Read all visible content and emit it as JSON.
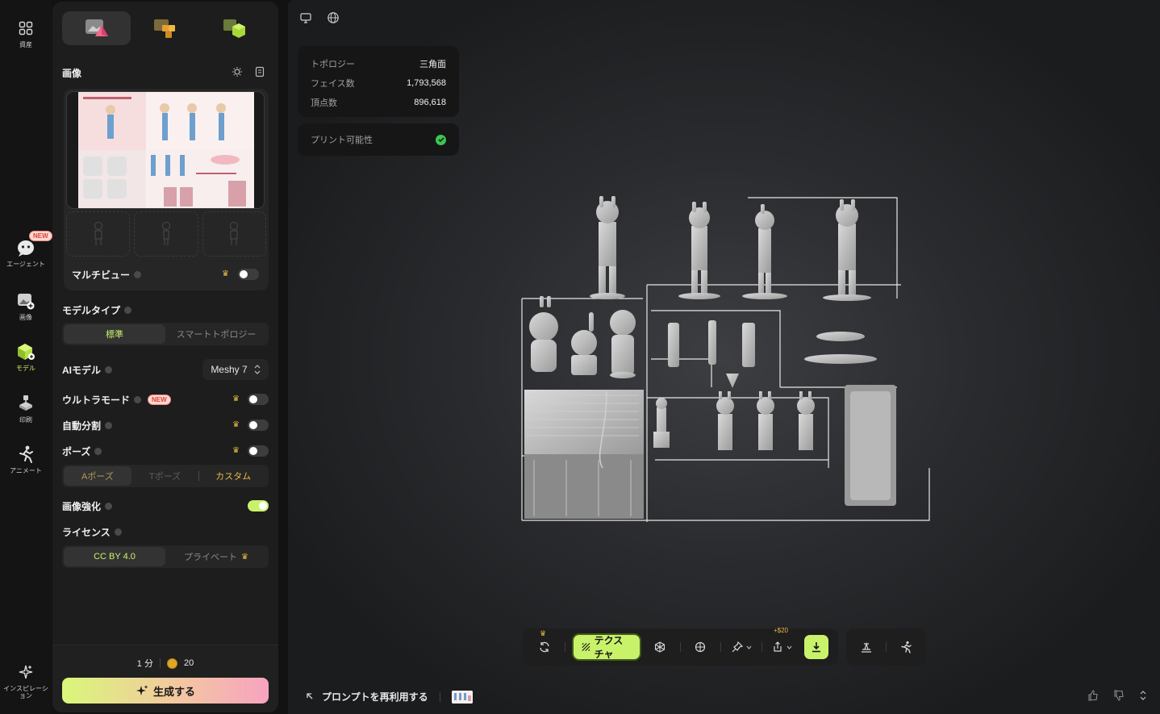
{
  "rail": {
    "assets_label": "資産",
    "agent_label": "エージェント",
    "agent_badge": "NEW",
    "image_label": "画像",
    "model_label": "モデル",
    "print_label": "印刷",
    "animate_label": "アニメート",
    "inspiration_label": "インスピレーション"
  },
  "panel": {
    "image_section": "画像",
    "multiview_label": "マルチビュー",
    "model_type_label": "モデルタイプ",
    "model_type_options": [
      "標準",
      "スマートトポロジー"
    ],
    "ai_model_label": "AIモデル",
    "ai_model_value": "Meshy 7",
    "ultra_mode_label": "ウルトラモード",
    "ultra_badge": "NEW",
    "auto_split_label": "自動分割",
    "pose_label": "ポーズ",
    "pose_options": [
      "Aポーズ",
      "Tポーズ",
      "カスタム"
    ],
    "image_enhance_label": "画像強化",
    "license_label": "ライセンス",
    "license_options": [
      "CC BY 4.0",
      "プライベート"
    ],
    "time_cost": "1 分",
    "credit_cost": "20",
    "generate_label": "生成する",
    "toggles": {
      "multiview": false,
      "ultra": false,
      "auto_split": false,
      "pose": false,
      "enhance": true
    }
  },
  "stats": {
    "topology_key": "トポロジー",
    "topology_value": "三角面",
    "faces_key": "フェイス数",
    "faces_value": "1,793,568",
    "vertices_key": "頂点数",
    "vertices_value": "896,618",
    "printability_label": "プリント可能性"
  },
  "toolbar": {
    "texture_label": "テクスチャ",
    "plus_credit": "+$20"
  },
  "bottom": {
    "reuse_prompt": "プロンプトを再利用する"
  },
  "colors": {
    "accent": "#c9f26b",
    "gold": "#e6b94a",
    "panel": "#1d1d1d",
    "viewport": "#2a2b2e"
  }
}
